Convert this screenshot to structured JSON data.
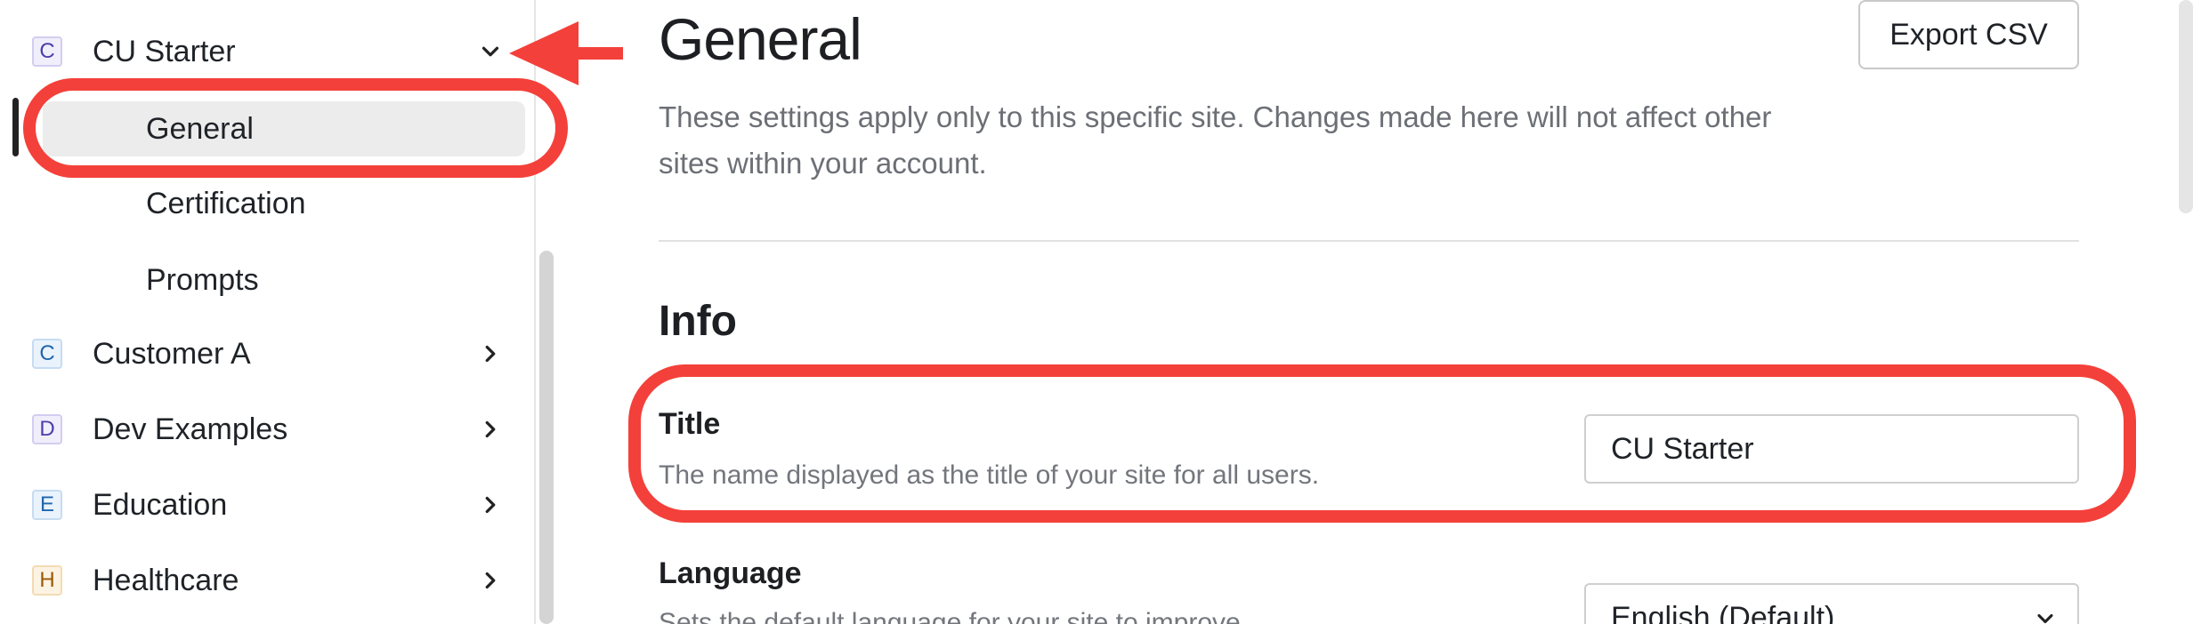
{
  "sidebar": {
    "sites": [
      {
        "letter": "C",
        "label": "CU Starter",
        "expanded": true,
        "color": "purple"
      },
      {
        "letter": "C",
        "label": "Customer A",
        "expanded": false,
        "color": "blue"
      },
      {
        "letter": "D",
        "label": "Dev Examples",
        "expanded": false,
        "color": "purple"
      },
      {
        "letter": "E",
        "label": "Education",
        "expanded": false,
        "color": "blue"
      },
      {
        "letter": "H",
        "label": "Healthcare",
        "expanded": false,
        "color": "yellow"
      }
    ],
    "sub_items": [
      {
        "label": "General",
        "active": true
      },
      {
        "label": "Certification",
        "active": false
      },
      {
        "label": "Prompts",
        "active": false
      }
    ]
  },
  "main": {
    "title": "General",
    "export_label": "Export CSV",
    "description": "These settings apply only to this specific site. Changes made here will not affect other sites within your account.",
    "section_title": "Info",
    "fields": {
      "title": {
        "label": "Title",
        "help": "The name displayed as the title of your site for all users.",
        "value": "CU Starter"
      },
      "language": {
        "label": "Language",
        "help": "Sets the default language for your site to improve",
        "value": "English (Default)"
      }
    }
  },
  "colors": {
    "annotation": "#f4403a",
    "active_bg": "#ececec"
  }
}
